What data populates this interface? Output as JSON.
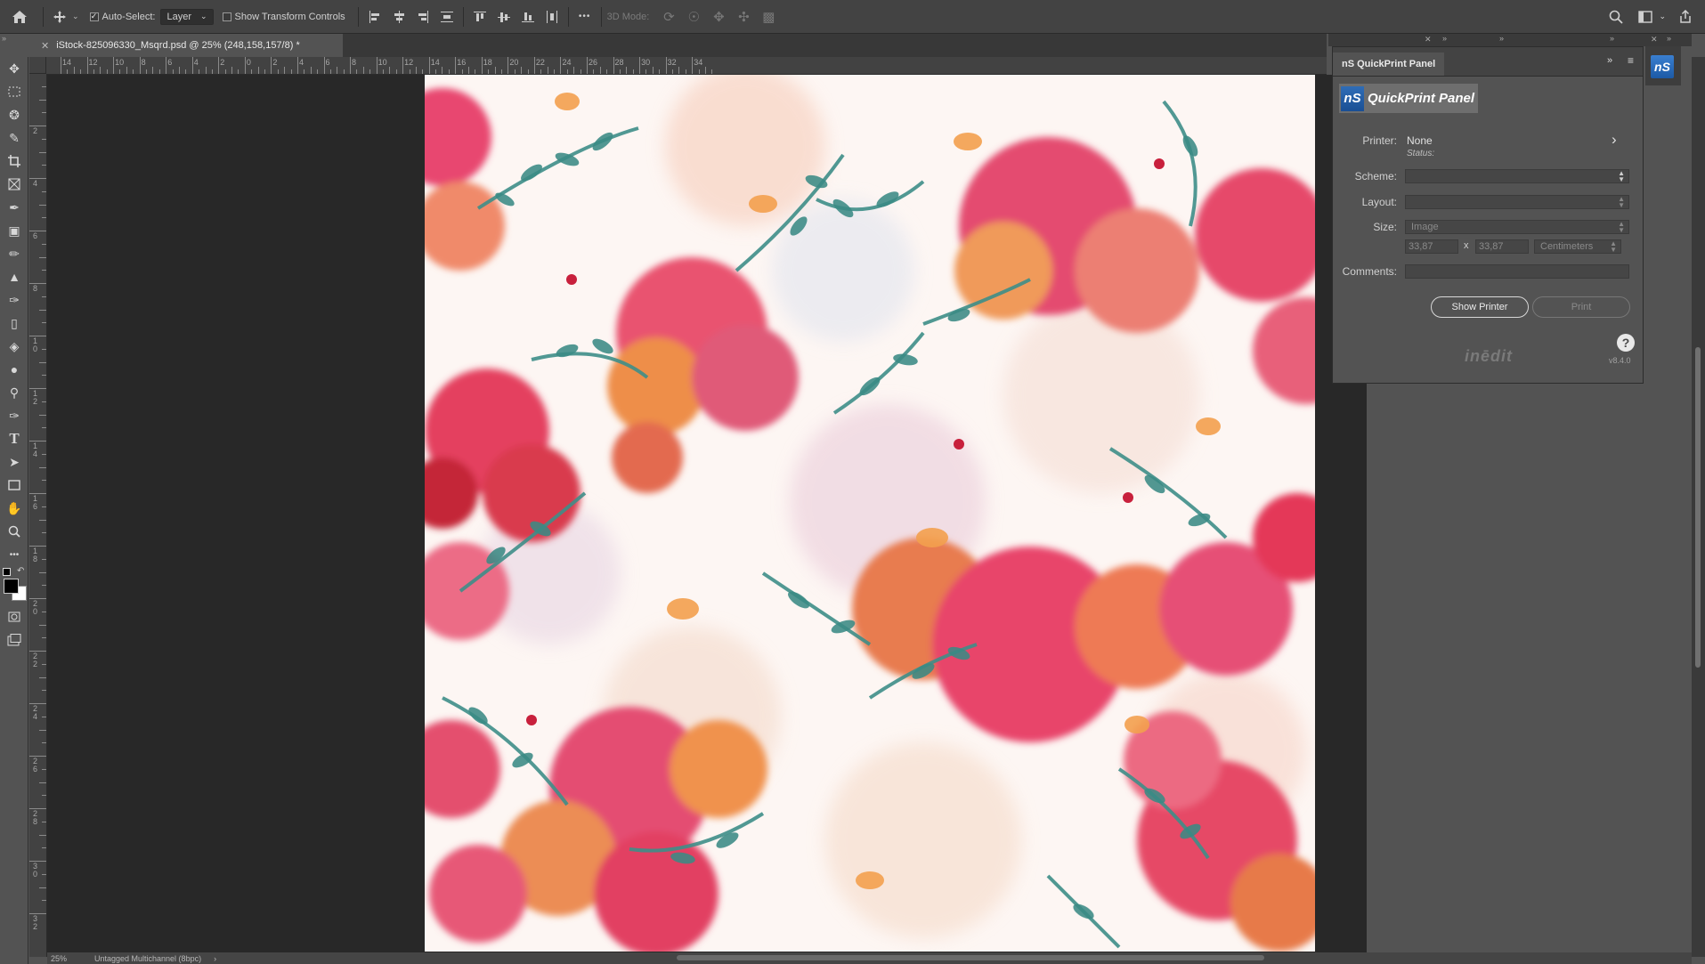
{
  "options_bar": {
    "auto_select_label": "Auto-Select:",
    "auto_select_target": "Layer",
    "show_transform_label": "Show Transform Controls",
    "mode_3d_label": "3D Mode:",
    "more_glyph": "•••"
  },
  "document": {
    "tab_title": "iStock-825096330_Msqrd.psd @ 25% (248,158,157/8) *",
    "zoom": "25%",
    "color_info": "Untagged Multichannel (8bpc)"
  },
  "rulers": {
    "h_labels": [
      "14",
      "12",
      "10",
      "8",
      "6",
      "4",
      "2",
      "0",
      "2",
      "4",
      "6",
      "8",
      "10",
      "12",
      "14",
      "16",
      "18",
      "20",
      "22",
      "24",
      "26",
      "28",
      "30",
      "32",
      "34"
    ],
    "v_labels": [
      "2",
      "4",
      "6",
      "8",
      "1\n0",
      "1\n2",
      "1\n4",
      "1\n6",
      "1\n8",
      "2\n0",
      "2\n2",
      "2\n4",
      "2\n6",
      "2\n8",
      "3\n0",
      "3\n2"
    ]
  },
  "quickprint_panel": {
    "tab_label": "nS QuickPrint Panel",
    "logo_badge": "nS",
    "logo_title": "QuickPrint Panel",
    "printer_label": "Printer:",
    "printer_value": "None",
    "status_label": "Status:",
    "scheme_label": "Scheme:",
    "layout_label": "Layout:",
    "size_label": "Size:",
    "size_value": "Image",
    "width_value": "33,87",
    "times_label": "x",
    "height_value": "33,87",
    "units_value": "Centimeters",
    "comments_label": "Comments:",
    "show_printer_button": "Show Printer",
    "print_button": "Print",
    "brand": "inēdit",
    "version": "v8.4.0"
  },
  "right_dock": {
    "icon_text": "nS"
  }
}
